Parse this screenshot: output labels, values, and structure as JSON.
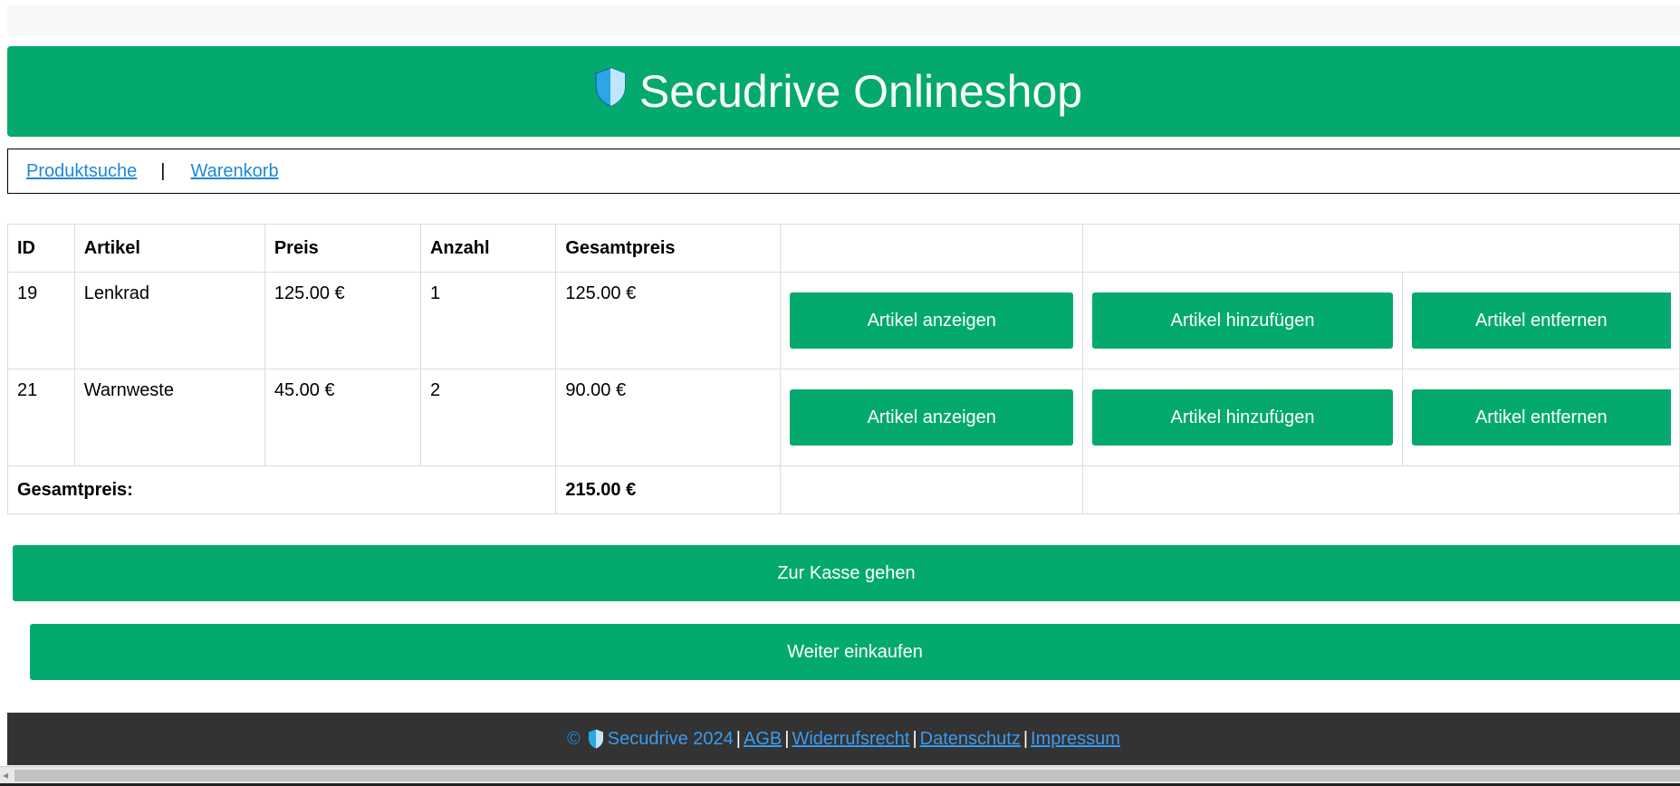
{
  "header": {
    "title": "Secudrive Onlineshop",
    "logo_icon": "shield-icon"
  },
  "nav": {
    "links": [
      "Produktsuche",
      "Warenkorb"
    ],
    "separator": "|"
  },
  "cart": {
    "columns": [
      "ID",
      "Artikel",
      "Preis",
      "Anzahl",
      "Gesamtpreis"
    ],
    "rows": [
      {
        "id": "19",
        "artikel": "Lenkrad",
        "preis": "125.00 €",
        "anzahl": "1",
        "gesamtpreis": "125.00 €"
      },
      {
        "id": "21",
        "artikel": "Warnweste",
        "preis": "45.00 €",
        "anzahl": "2",
        "gesamtpreis": "90.00 €"
      }
    ],
    "row_actions": {
      "show": "Artikel anzeigen",
      "add": "Artikel hinzufügen",
      "remove": "Artikel entfernen"
    },
    "total_label": "Gesamtpreis:",
    "total_value": "215.00 €"
  },
  "actions": {
    "checkout": "Zur Kasse gehen",
    "continue": "Weiter einkaufen"
  },
  "footer": {
    "copyright": "©",
    "brand": "Secudrive 2024",
    "links": [
      "AGB ",
      "Widerrufsrecht ",
      "Datenschutz ",
      "Impressum"
    ]
  },
  "colors": {
    "accent": "#04aa6d",
    "link": "#1e88d6",
    "footer_bg": "#333333"
  }
}
